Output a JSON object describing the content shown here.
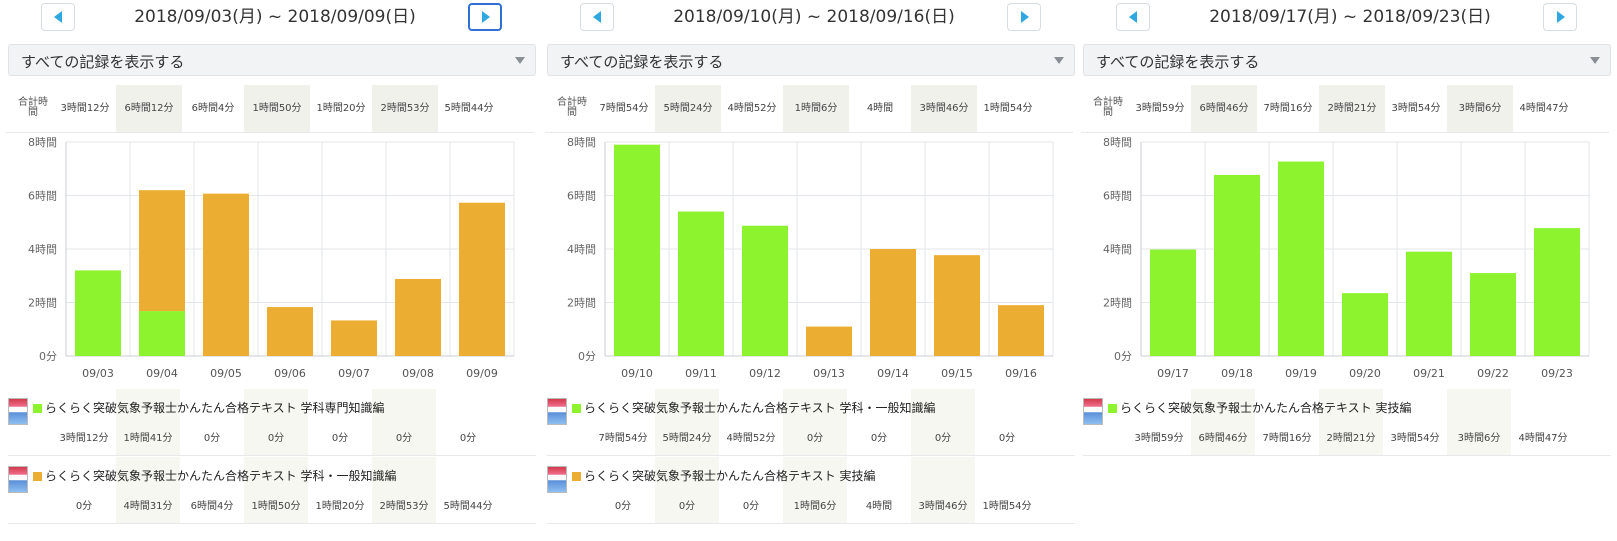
{
  "colors": {
    "green": "#8ef32f",
    "orange": "#ecad33",
    "accent": "#2fa7e0",
    "active_border": "#2f6fd6"
  },
  "icons": {
    "prev": "caret-left-icon",
    "next": "caret-right-icon",
    "dropdown": "caret-down-icon",
    "book": "book-cover-icon"
  },
  "totals_label": "合計時間",
  "panels": [
    {
      "range": "2018/09/03(月) ~ 2018/09/09(日)",
      "next_active": true,
      "filter": "すべての記録を表示する",
      "totals": [
        "3時間12分",
        "6時間12分",
        "6時間4分",
        "1時間50分",
        "1時間20分",
        "2時間53分",
        "5時間44分"
      ],
      "chart_data": {
        "type": "bar",
        "stacked": true,
        "categories": [
          "09/03",
          "09/04",
          "09/05",
          "09/06",
          "09/07",
          "09/08",
          "09/09"
        ],
        "yticks": [
          "0分",
          "2時間",
          "4時間",
          "6時間",
          "8時間"
        ],
        "ylim_hours": [
          0,
          8
        ],
        "series": [
          {
            "color": "#8ef32f",
            "values": [
              3.2,
              1.68,
              0,
              0,
              0,
              0,
              0
            ]
          },
          {
            "color": "#ecad33",
            "values": [
              0,
              4.52,
              6.07,
              1.83,
              1.33,
              2.88,
              5.73
            ]
          }
        ]
      },
      "books": [
        {
          "color": "#8ef32f",
          "title": "らくらく突破気象予報士かんたん合格テキスト 学科専門知識編",
          "values": [
            "3時間12分",
            "1時間41分",
            "0分",
            "0分",
            "0分",
            "0分",
            "0分"
          ]
        },
        {
          "color": "#ecad33",
          "title": "らくらく突破気象予報士かんたん合格テキスト 学科・一般知識編",
          "values": [
            "0分",
            "4時間31分",
            "6時間4分",
            "1時間50分",
            "1時間20分",
            "2時間53分",
            "5時間44分"
          ]
        }
      ]
    },
    {
      "range": "2018/09/10(月) ~ 2018/09/16(日)",
      "next_active": false,
      "filter": "すべての記録を表示する",
      "totals": [
        "7時間54分",
        "5時間24分",
        "4時間52分",
        "1時間6分",
        "4時間",
        "3時間46分",
        "1時間54分"
      ],
      "chart_data": {
        "type": "bar",
        "stacked": true,
        "categories": [
          "09/10",
          "09/11",
          "09/12",
          "09/13",
          "09/14",
          "09/15",
          "09/16"
        ],
        "yticks": [
          "0分",
          "2時間",
          "4時間",
          "6時間",
          "8時間"
        ],
        "ylim_hours": [
          0,
          8
        ],
        "series": [
          {
            "color": "#8ef32f",
            "values": [
              7.9,
              5.4,
              4.87,
              0,
              0,
              0,
              0
            ]
          },
          {
            "color": "#ecad33",
            "values": [
              0,
              0,
              0,
              1.1,
              4.0,
              3.77,
              1.9
            ]
          }
        ]
      },
      "books": [
        {
          "color": "#8ef32f",
          "title": "らくらく突破気象予報士かんたん合格テキスト 学科・一般知識編",
          "values": [
            "7時間54分",
            "5時間24分",
            "4時間52分",
            "0分",
            "0分",
            "0分",
            "0分"
          ]
        },
        {
          "color": "#ecad33",
          "title": "らくらく突破気象予報士かんたん合格テキスト 実技編",
          "values": [
            "0分",
            "0分",
            "0分",
            "1時間6分",
            "4時間",
            "3時間46分",
            "1時間54分"
          ]
        }
      ]
    },
    {
      "range": "2018/09/17(月) ~ 2018/09/23(日)",
      "next_active": false,
      "filter": "すべての記録を表示する",
      "totals": [
        "3時間59分",
        "6時間46分",
        "7時間16分",
        "2時間21分",
        "3時間54分",
        "3時間6分",
        "4時間47分"
      ],
      "chart_data": {
        "type": "bar",
        "stacked": true,
        "categories": [
          "09/17",
          "09/18",
          "09/19",
          "09/20",
          "09/21",
          "09/22",
          "09/23"
        ],
        "yticks": [
          "0分",
          "2時間",
          "4時間",
          "6時間",
          "8時間"
        ],
        "ylim_hours": [
          0,
          8
        ],
        "series": [
          {
            "color": "#8ef32f",
            "values": [
              3.98,
              6.77,
              7.27,
              2.35,
              3.9,
              3.1,
              4.78
            ]
          }
        ]
      },
      "books": [
        {
          "color": "#8ef32f",
          "title": "らくらく突破気象予報士かんたん合格テキスト 実技編",
          "values": [
            "3時間59分",
            "6時間46分",
            "7時間16分",
            "2時間21分",
            "3時間54分",
            "3時間6分",
            "4時間47分"
          ]
        }
      ]
    }
  ]
}
